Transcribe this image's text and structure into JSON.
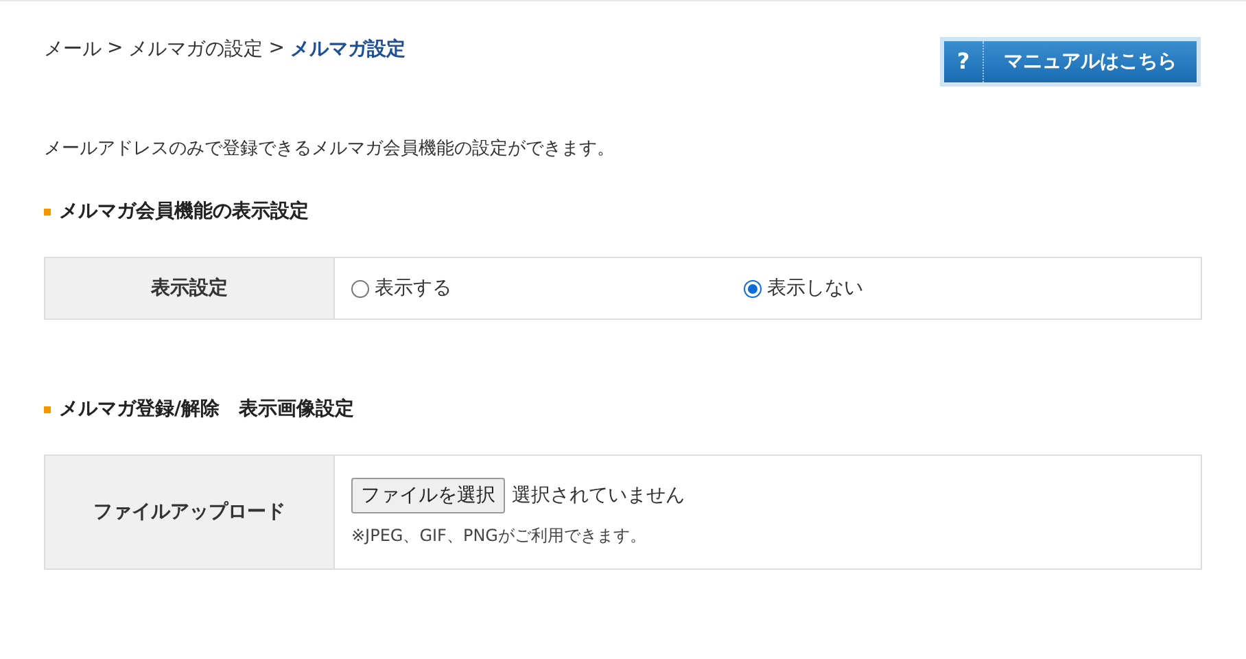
{
  "breadcrumb": [
    {
      "kind": "link",
      "label": "メール"
    },
    {
      "kind": "separator",
      "label": ">"
    },
    {
      "kind": "link",
      "label": "メルマガの設定"
    },
    {
      "kind": "separator",
      "label": ">"
    },
    {
      "kind": "current",
      "label": "メルマガ設定"
    }
  ],
  "manual_button": {
    "icon": "?",
    "label": "マニュアルはこちら"
  },
  "description": "メールアドレスのみで登録できるメルマガ会員機能の設定ができます。",
  "sections": [
    {
      "title": "メルマガ会員機能の表示設定",
      "rows": [
        {
          "kind": "radio",
          "label": "表示設定",
          "options": [
            {
              "label": "表示する",
              "selected": false
            },
            {
              "label": "表示しない",
              "selected": true
            }
          ]
        }
      ]
    },
    {
      "title": "メルマガ登録/解除　表示画像設定",
      "rows": [
        {
          "kind": "file",
          "label": "ファイルアップロード",
          "button": "ファイルを選択",
          "status": "選択されていません",
          "note": "※JPEG、GIF、PNGがご利用できます。"
        }
      ]
    }
  ]
}
